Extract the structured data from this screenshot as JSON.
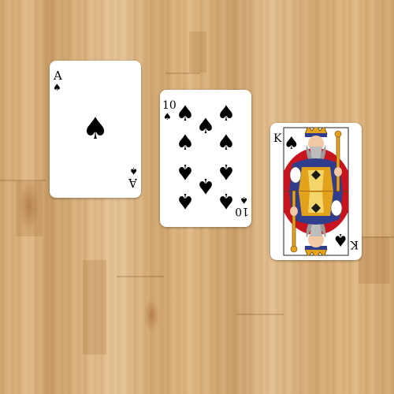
{
  "cards": {
    "ace": {
      "rank": "A",
      "suit": "spades",
      "suit_symbol": "♠"
    },
    "ten": {
      "rank": "10",
      "suit": "spades",
      "suit_symbol": "♠"
    },
    "king": {
      "rank": "K",
      "suit": "spades",
      "suit_symbol": "♠"
    }
  },
  "colors": {
    "table_wood": "#d8b27e",
    "card_face": "#ffffff",
    "suit_ink": "#000000",
    "king_red": "#c8141e",
    "king_gold": "#e2a21b",
    "king_blue": "#2f3d8c"
  }
}
